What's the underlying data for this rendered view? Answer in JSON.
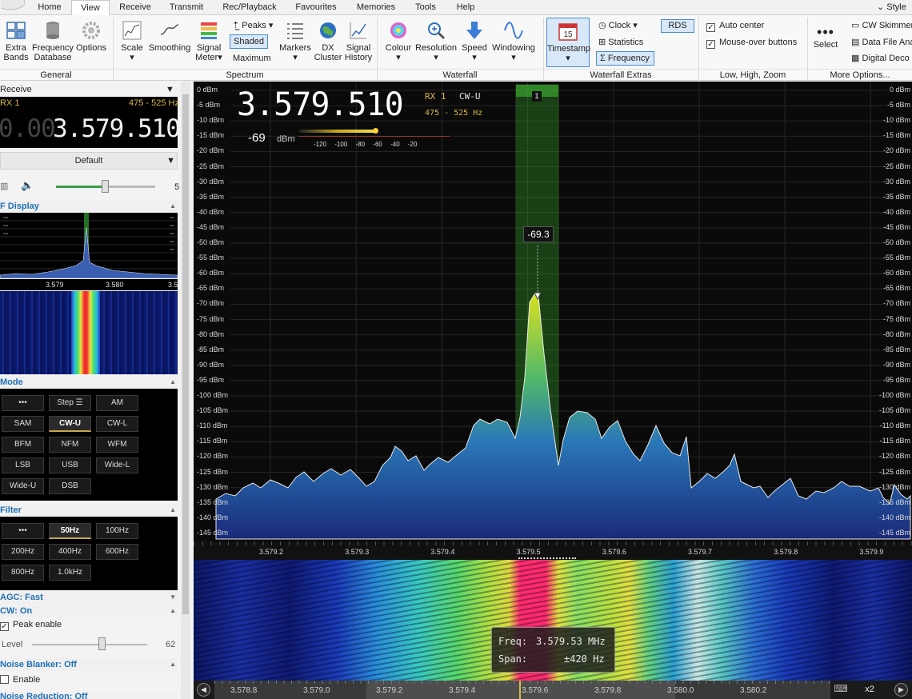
{
  "ribbon": {
    "style_label": "Style",
    "tabs": [
      "Home",
      "View",
      "Receive",
      "Transmit",
      "Rec/Playback",
      "Favourites",
      "Memories",
      "Tools",
      "Help"
    ],
    "active_tab": "View",
    "general": {
      "extra_bands": "Extra\nBands",
      "freq_db": "Frequency\nDatabase",
      "options": "Options",
      "group": "General"
    },
    "spectrum": {
      "scale": "Scale",
      "smoothing": "Smoothing",
      "signal_meter": "Signal\nMeter",
      "peaks": "Peaks",
      "shaded": "Shaded",
      "maximum": "Maximum",
      "markers": "Markers",
      "dx_cluster": "DX\nCluster",
      "signal_history": "Signal\nHistory",
      "group": "Spectrum"
    },
    "waterfall": {
      "colour": "Colour",
      "resolution": "Resolution",
      "speed": "Speed",
      "windowing": "Windowing",
      "group": "Waterfall"
    },
    "waterfall_extras": {
      "timestamp": "Timestamp",
      "timestamp_icon": "15",
      "clock": "Clock",
      "statistics": "Statistics",
      "frequency": "Frequency",
      "rds": "RDS",
      "group": "Waterfall Extras"
    },
    "zoom": {
      "auto_center": "Auto center",
      "mouse_over": "Mouse-over buttons",
      "group": "Low, High, Zoom"
    },
    "more": {
      "select": "Select",
      "cw_skimmer": "CW Skimmer",
      "data_file": "Data File Ana",
      "digital": "Digital Deco",
      "group": "More Options..."
    }
  },
  "receive": {
    "title": "Receive",
    "rx": "RX 1",
    "band": "475 - 525 Hz",
    "freq_dim": "0.00",
    "freq_main": "3.579.510",
    "profile": "Default",
    "volume_value": "5"
  },
  "if_display": {
    "title": "F Display",
    "tick1": "3.579",
    "tick2": "3.580",
    "tick3": "3.5"
  },
  "mode": {
    "title": "Mode",
    "buttons": [
      "•••",
      "Step ☰",
      "AM",
      "SAM",
      "CW-U",
      "CW-L",
      "BFM",
      "NFM",
      "WFM",
      "LSB",
      "USB",
      "Wide-L",
      "Wide-U",
      "DSB"
    ]
  },
  "filter": {
    "title": "Filter",
    "buttons": [
      "•••",
      "50Hz",
      "100Hz",
      "200Hz",
      "400Hz",
      "600Hz",
      "800Hz",
      "1.0kHz"
    ]
  },
  "agc": {
    "label": "AGC: Fast"
  },
  "cw": {
    "label": "CW: On",
    "peak_enable": "Peak enable",
    "level_label": "Level",
    "level_value": "62"
  },
  "noise_blanker": {
    "label": "Noise Blanker: Off",
    "enable": "Enable"
  },
  "noise_reduction": {
    "label": "Noise Reduction: Off"
  },
  "spectrum": {
    "freq_big": "3.579.510",
    "rx": "RX 1",
    "mode": "CW-U",
    "band": "475 - 525 Hz",
    "level": "-69",
    "level_unit": "dBm",
    "meter_ticks": [
      "-120",
      "-100",
      "-80",
      "-60",
      "-40",
      "-20"
    ],
    "marker_number": "1",
    "peak_label": "-69.3",
    "db_labels": [
      "0 dBm",
      "-5 dBm",
      "-10 dBm",
      "-15 dBm",
      "-20 dBm",
      "-25 dBm",
      "-30 dBm",
      "-35 dBm",
      "-40 dBm",
      "-45 dBm",
      "-50 dBm",
      "-55 dBm",
      "-60 dBm",
      "-65 dBm",
      "-70 dBm",
      "-75 dBm",
      "-80 dBm",
      "-85 dBm",
      "-90 dBm",
      "-95 dBm",
      "-100 dBm",
      "-105 dBm",
      "-110 dBm",
      "-115 dBm",
      "-120 dBm",
      "-125 dBm",
      "-130 dBm",
      "-135 dBm",
      "-140 dBm",
      "-145 dBm"
    ],
    "freq_labels": [
      "3.579.2",
      "3.579.3",
      "3.579.4",
      "3.579.5",
      "3.579.6",
      "3.579.7",
      "3.579.8",
      "3.579.9"
    ]
  },
  "waterfall": {
    "tooltip_freq_label": "Freq:",
    "tooltip_freq": "3.579.53 MHz",
    "tooltip_span_label": "Span:",
    "tooltip_span": "±420 Hz",
    "scale_labels": [
      "3.578.8",
      "3.579.0",
      "3.579.2",
      "3.579.4",
      "3.579.6",
      "3.579.8",
      "3.580.0",
      "3.580.2"
    ],
    "zoom": "x2"
  },
  "colors": {
    "accent": "#1e6fb3",
    "passband": "#3ea82e",
    "lcd": "#000000"
  }
}
